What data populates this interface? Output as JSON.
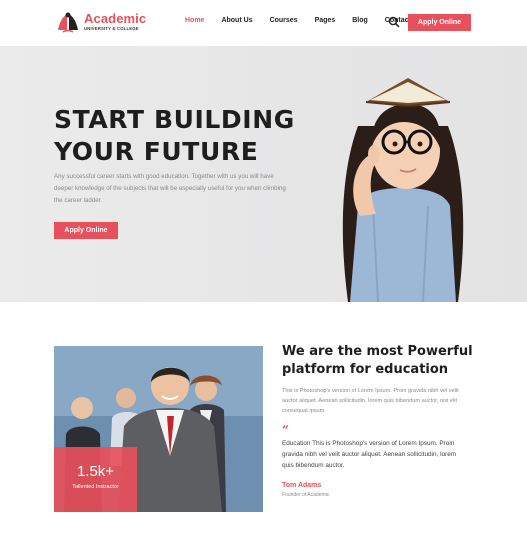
{
  "logo": {
    "name": "Academic",
    "sub": "UNIVERSITY & COLLEGE"
  },
  "nav": {
    "items": [
      "Home",
      "About Us",
      "Courses",
      "Pages",
      "Blog",
      "Contact Us"
    ],
    "active": "Home"
  },
  "header": {
    "apply_label": "Apply Online"
  },
  "hero": {
    "title_line1": "START BUILDING",
    "title_line2": "YOUR FUTURE",
    "description": "Any successful career starts with good education. Together with us you will have deeper knowledge of the subjects that will be especially useful for you when climbing the career ladder.",
    "apply_label": "Apply Online"
  },
  "about": {
    "title_line1": "We are the most Powerful",
    "title_line2": "platform for education",
    "paragraph1": "This is Photoshop's version  of Lorem Ipsum. Proin gravida nibh vel velit auctor aliquet. Aenean sollicitudin, lorem quis bibendum auctor, nisi elit consequat ipsum.",
    "quote": "“",
    "paragraph2": "Education This is Photoshop's version  of Lorem Ipsum. Proin gravida nibh vel velit auctor aliquet. Aenean sollicitudin, lorem quis bibendum auctor.",
    "author_name": "Tom Adams",
    "author_role": "Founder of Academic",
    "stat_value": "1.5k+",
    "stat_label": "Tallented Instractor"
  },
  "colors": {
    "accent": "#e8505b",
    "hero_bg": "#e7e7e8",
    "dark_text": "#1e1e1e",
    "muted_text": "#8a8a8a"
  }
}
